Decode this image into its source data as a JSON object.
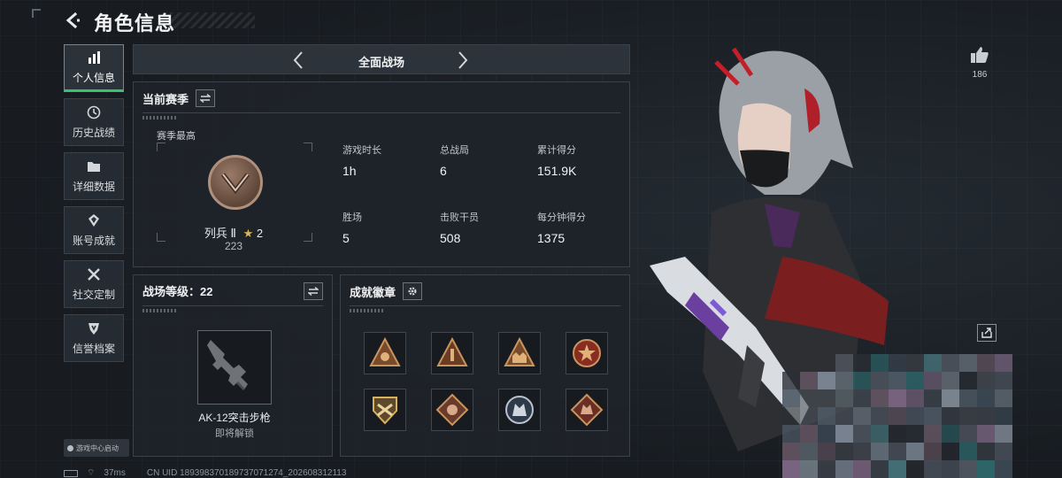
{
  "header": {
    "title": "角色信息"
  },
  "sidebar": {
    "items": [
      {
        "label": "个人信息",
        "icon": "bar-chart-icon",
        "active": true
      },
      {
        "label": "历史战绩",
        "icon": "clock-icon"
      },
      {
        "label": "详细数据",
        "icon": "folder-icon"
      },
      {
        "label": "账号成就",
        "icon": "achievement-icon"
      },
      {
        "label": "社交定制",
        "icon": "tools-icon"
      },
      {
        "label": "信誉档案",
        "icon": "shield-icon"
      }
    ]
  },
  "mode": {
    "title": "全面战场"
  },
  "season": {
    "title": "当前赛季",
    "subtitle": "赛季最高",
    "rank_name": "列兵 Ⅱ",
    "rank_stars": "2",
    "rank_score": "223",
    "stats": [
      {
        "label": "游戏时长",
        "value": "1h"
      },
      {
        "label": "总战局",
        "value": "6"
      },
      {
        "label": "累计得分",
        "value": "151.9K"
      },
      {
        "label": "胜场",
        "value": "5"
      },
      {
        "label": "击败干员",
        "value": "508"
      },
      {
        "label": "每分钟得分",
        "value": "1375"
      }
    ]
  },
  "battlefield_level": {
    "title": "战场等级：22",
    "weapon_name": "AK-12突击步枪",
    "weapon_status": "即将解锁"
  },
  "medals": {
    "title": "成就徽章",
    "count": 8
  },
  "right": {
    "like_count": "186"
  },
  "footer": {
    "launch_tag": "游戏中心启动",
    "ping": "37ms",
    "uid": "CN UID 18939837018973707127​4_202608312113"
  },
  "colors": {
    "accent": "#35c46e",
    "panel": "#1e2329",
    "rank_bronze": "#9b7a68"
  }
}
